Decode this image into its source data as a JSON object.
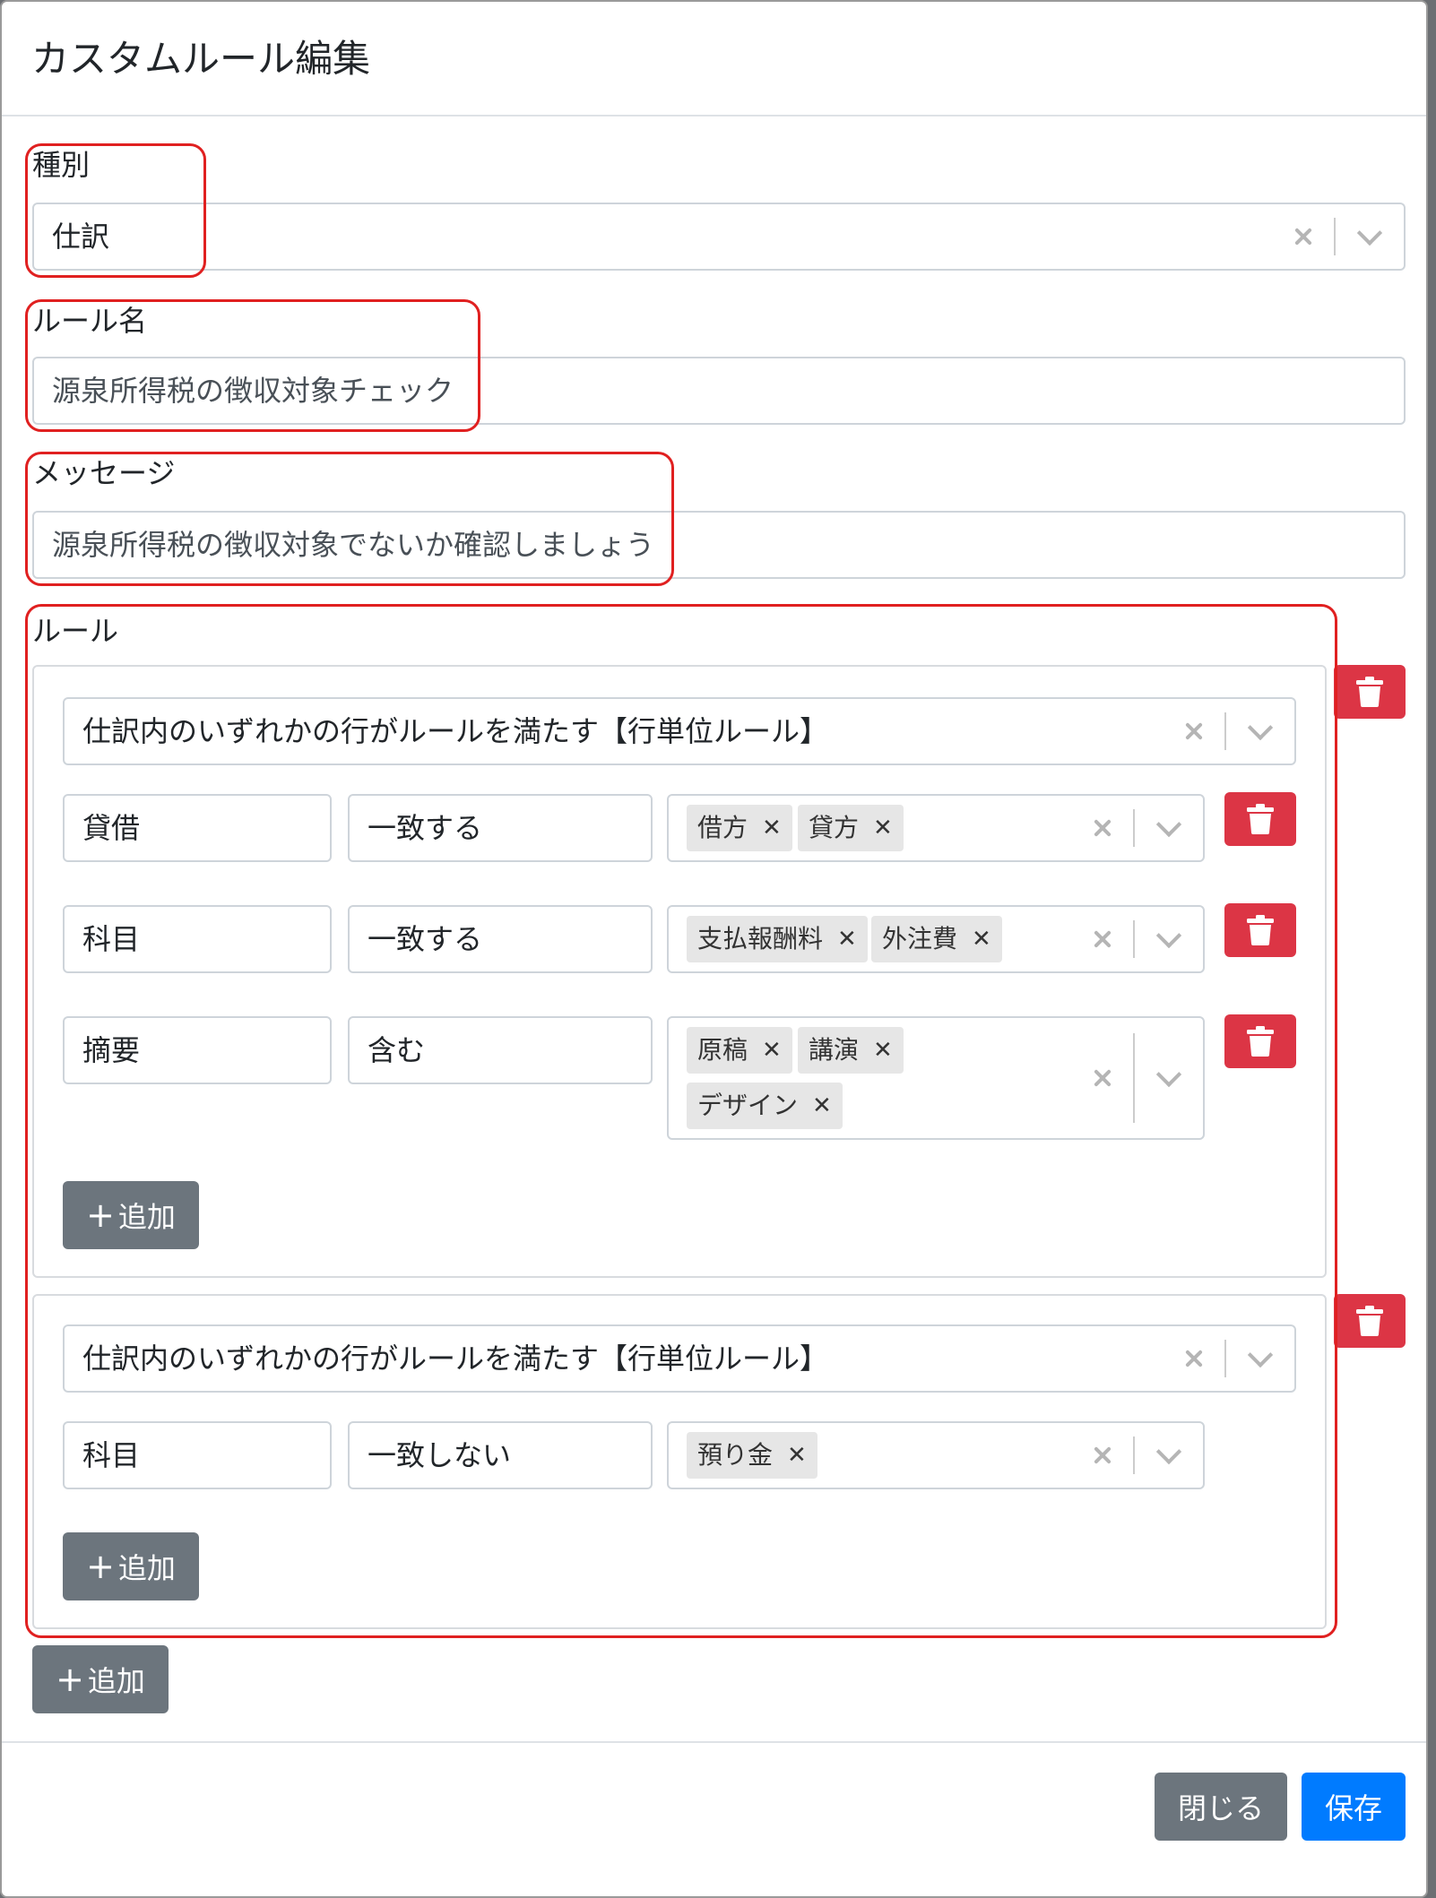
{
  "modal": {
    "title": "カスタムルール編集"
  },
  "type": {
    "label": "種別",
    "value": "仕訳"
  },
  "rule_name": {
    "label": "ルール名",
    "value": "源泉所得税の徴収対象チェック"
  },
  "message": {
    "label": "メッセージ",
    "value": "源泉所得税の徴収対象でないか確認しましょう"
  },
  "rules": {
    "label": "ルール",
    "groups": [
      {
        "scope": "仕訳内のいずれかの行がルールを満たす【行単位ルール】",
        "conditions": [
          {
            "field": "貸借",
            "operator": "一致する",
            "values": [
              "借方",
              "貸方"
            ]
          },
          {
            "field": "科目",
            "operator": "一致する",
            "values": [
              "支払報酬料",
              "外注費"
            ]
          },
          {
            "field": "摘要",
            "operator": "含む",
            "values": [
              "原稿",
              "講演",
              "デザイン"
            ]
          }
        ],
        "add_label": "追加"
      },
      {
        "scope": "仕訳内のいずれかの行がルールを満たす【行単位ルール】",
        "conditions": [
          {
            "field": "科目",
            "operator": "一致しない",
            "values": [
              "預り金"
            ]
          }
        ],
        "add_label": "追加"
      }
    ],
    "add_label": "追加"
  },
  "footer": {
    "close_label": "閉じる",
    "save_label": "保存"
  },
  "colors": {
    "danger": "#dc3545",
    "secondary": "#6c757d",
    "primary": "#007bff",
    "highlight": "#e02020"
  }
}
